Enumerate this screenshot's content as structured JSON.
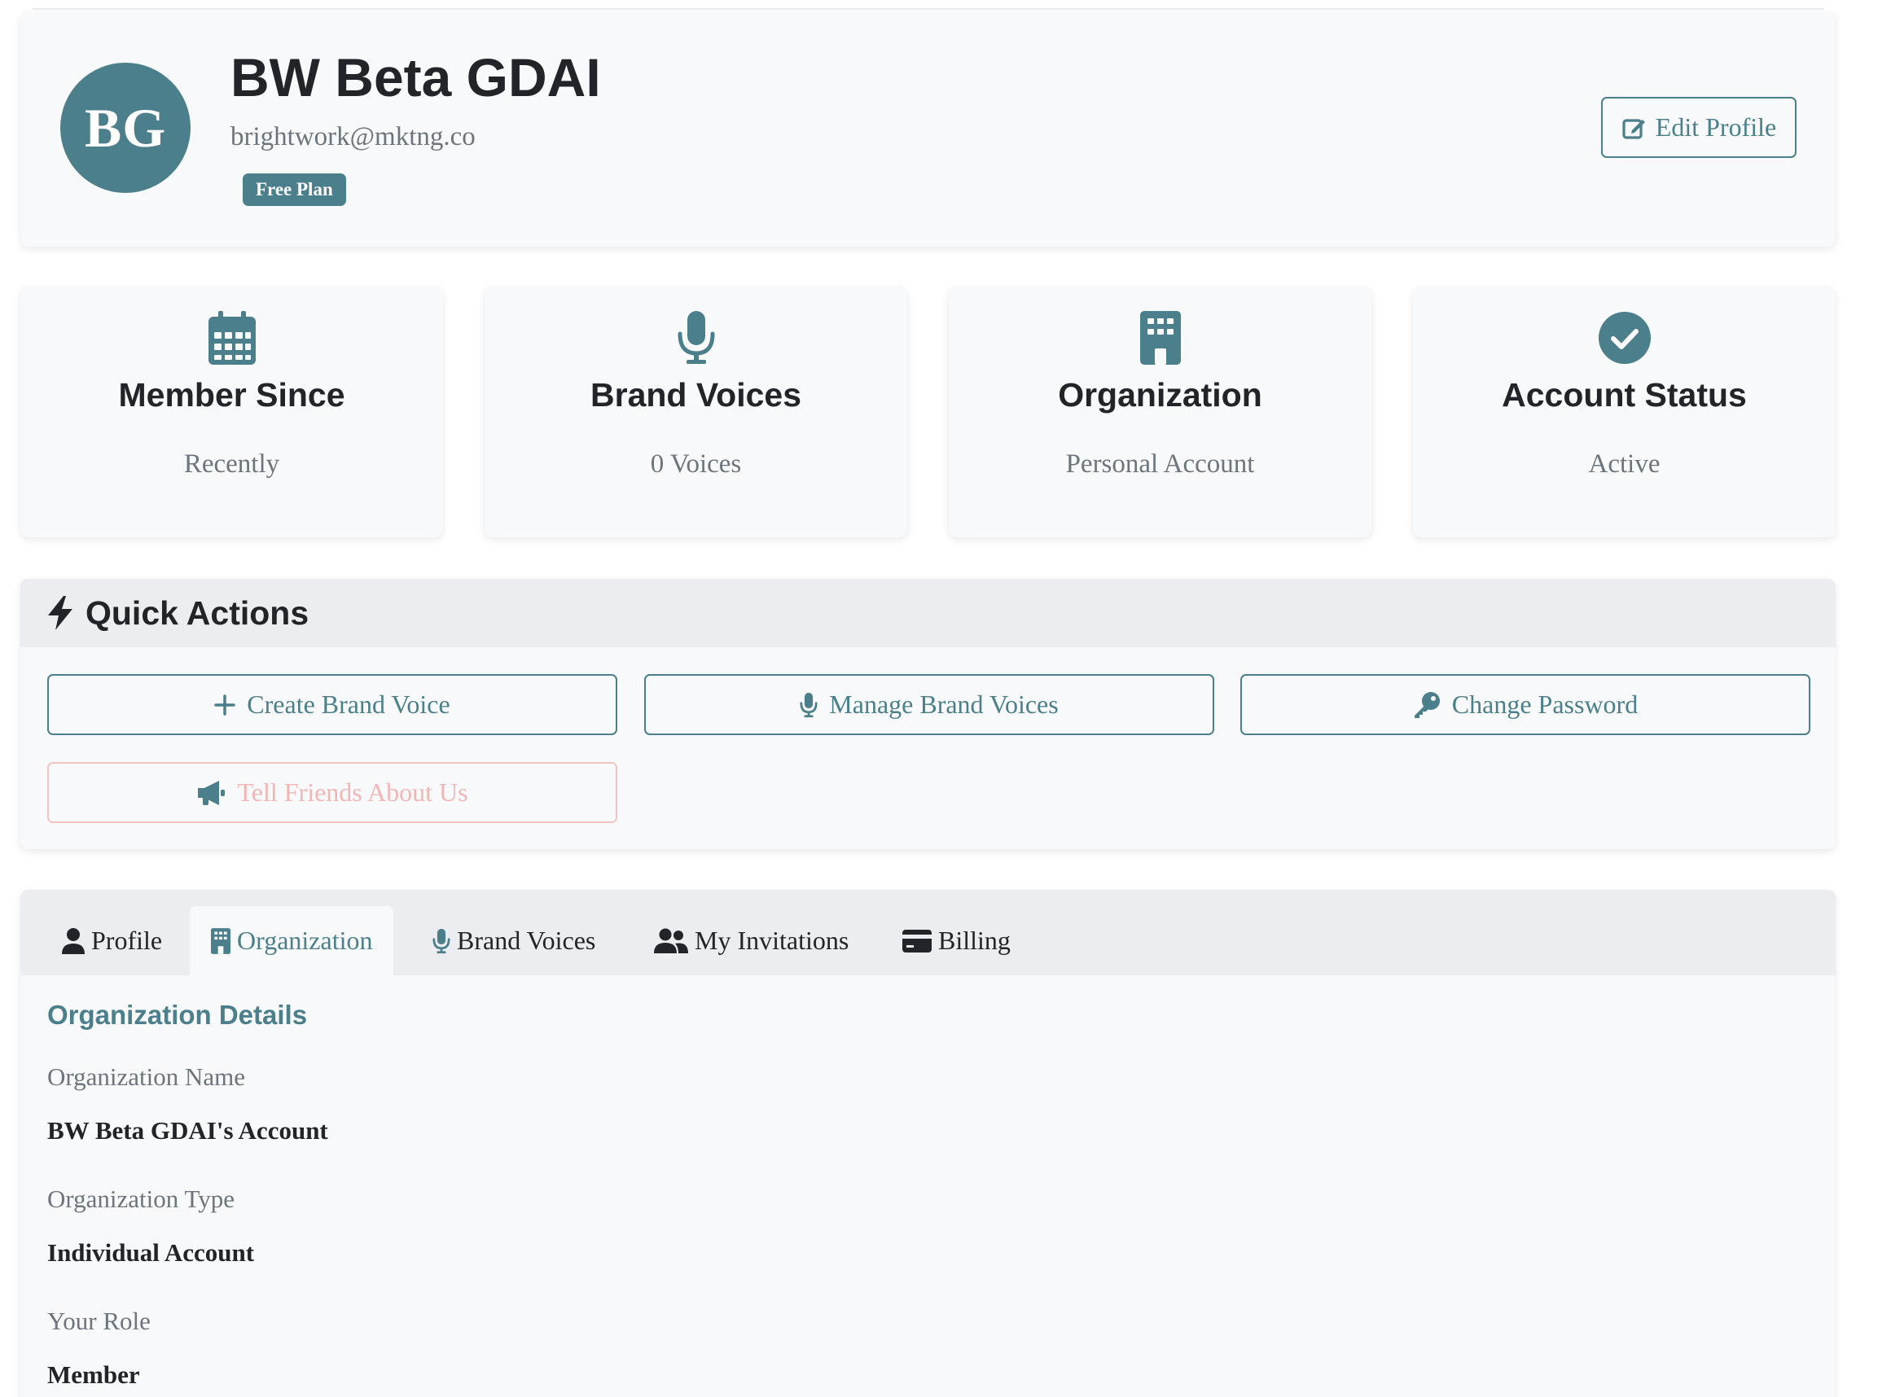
{
  "profile": {
    "initials": "BG",
    "name": "BW Beta GDAI",
    "email": "brightwork@mktng.co",
    "plan_badge": "Free Plan",
    "edit_label": "Edit Profile"
  },
  "stats": [
    {
      "title": "Member Since",
      "value": "Recently",
      "icon": "calendar-icon"
    },
    {
      "title": "Brand Voices",
      "value": "0 Voices",
      "icon": "microphone-icon"
    },
    {
      "title": "Organization",
      "value": "Personal Account",
      "icon": "building-icon"
    },
    {
      "title": "Account Status",
      "value": "Active",
      "icon": "check-circle-icon"
    }
  ],
  "quick_actions": {
    "title": "Quick Actions",
    "buttons": [
      {
        "label": "Create Brand Voice",
        "icon": "plus-icon"
      },
      {
        "label": "Manage Brand Voices",
        "icon": "microphone-icon"
      },
      {
        "label": "Change Password",
        "icon": "key-icon"
      },
      {
        "label": "Tell Friends About Us",
        "icon": "megaphone-icon"
      }
    ]
  },
  "tabs": [
    {
      "label": "Profile",
      "icon": "user-icon",
      "active": false
    },
    {
      "label": "Organization",
      "icon": "building-icon",
      "active": true
    },
    {
      "label": "Brand Voices",
      "icon": "microphone-icon",
      "active": false
    },
    {
      "label": "My Invitations",
      "icon": "users-icon",
      "active": false
    },
    {
      "label": "Billing",
      "icon": "credit-card-icon",
      "active": false
    }
  ],
  "organization": {
    "section_title": "Organization Details",
    "fields": [
      {
        "label": "Organization Name",
        "value": "BW Beta GDAI's Account"
      },
      {
        "label": "Organization Type",
        "value": "Individual Account"
      },
      {
        "label": "Your Role",
        "value": "Member"
      }
    ]
  },
  "colors": {
    "accent": "#4a7f8b",
    "muted_text": "#6c757d",
    "faded_button": "#f2b6b6"
  }
}
